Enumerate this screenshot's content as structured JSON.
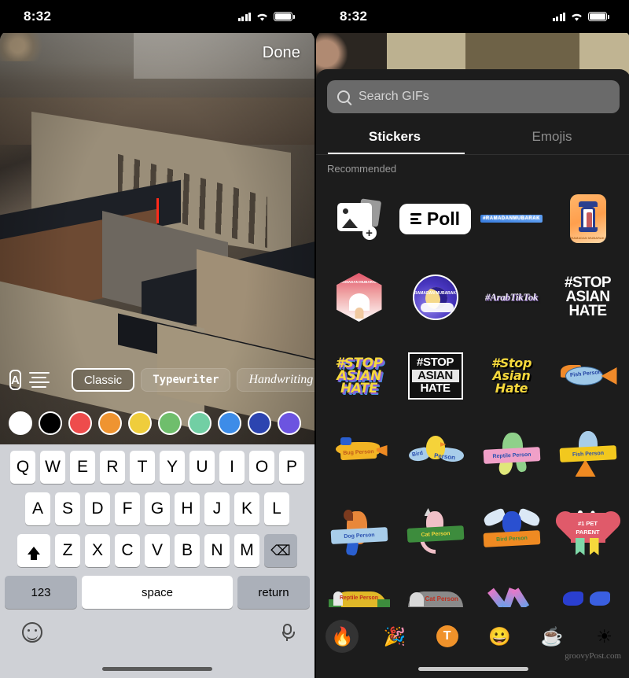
{
  "left": {
    "status": {
      "time": "8:32",
      "cellular_icon": "signal-bars-icon",
      "wifi_icon": "wifi-icon",
      "battery_icon": "battery-icon"
    },
    "done_label": "Done",
    "toolbar": {
      "text_style_icon": "letter-A-box-icon",
      "align_icon": "text-align-icon",
      "fonts": [
        {
          "label": "Classic",
          "selected": true
        },
        {
          "label": "Typewriter",
          "selected": false
        },
        {
          "label": "Handwriting",
          "selected": false
        }
      ]
    },
    "colors": [
      {
        "name": "white",
        "hex": "#FFFFFF",
        "selected": true
      },
      {
        "name": "black",
        "hex": "#000000",
        "selected": false
      },
      {
        "name": "red",
        "hex": "#EE4C4C",
        "selected": false
      },
      {
        "name": "orange",
        "hex": "#EF9431",
        "selected": false
      },
      {
        "name": "yellow",
        "hex": "#EFCD3C",
        "selected": false
      },
      {
        "name": "green",
        "hex": "#6FBE6C",
        "selected": false
      },
      {
        "name": "mint",
        "hex": "#72CFA4",
        "selected": false
      },
      {
        "name": "blue",
        "hex": "#3D8CE8",
        "selected": false
      },
      {
        "name": "navy",
        "hex": "#2C44B0",
        "selected": false
      },
      {
        "name": "purple",
        "hex": "#6C54E0",
        "selected": false
      }
    ],
    "keyboard": {
      "row1": [
        "Q",
        "W",
        "E",
        "R",
        "T",
        "Y",
        "U",
        "I",
        "O",
        "P"
      ],
      "row2": [
        "A",
        "S",
        "D",
        "F",
        "G",
        "H",
        "J",
        "K",
        "L"
      ],
      "row3": [
        "Z",
        "X",
        "C",
        "V",
        "B",
        "N",
        "M"
      ],
      "shift_icon": "shift-arrow-icon",
      "delete_icon": "backspace-icon",
      "numbers_label": "123",
      "space_label": "space",
      "return_label": "return",
      "emoji_icon": "emoji-smiley-icon",
      "dictation_icon": "microphone-icon"
    }
  },
  "right": {
    "status": {
      "time": "8:32",
      "cellular_icon": "signal-bars-icon",
      "wifi_icon": "wifi-icon",
      "battery_icon": "battery-icon"
    },
    "search": {
      "placeholder": "Search GIFs",
      "icon": "search-icon"
    },
    "tabs": [
      {
        "label": "Stickers",
        "active": true
      },
      {
        "label": "Emojis",
        "active": false
      }
    ],
    "section_title": "Recommended",
    "stickers": [
      [
        {
          "name": "add-photo-sticker",
          "label": ""
        },
        {
          "name": "poll-sticker",
          "label": "Poll"
        },
        {
          "name": "ramadan-mubarak-text-sticker",
          "label": "#RAMADANMUBARAK"
        },
        {
          "name": "ramadan-lantern-sticker",
          "label": "RAMADAN MUBARAK"
        }
      ],
      [
        {
          "name": "ramadan-mosque-hexagon-sticker",
          "label": "RAMADAN MUBARAK"
        },
        {
          "name": "ramadan-moon-circle-sticker",
          "label": "RAMADAN MUBARAK"
        },
        {
          "name": "arab-tiktok-sticker",
          "label": "#ArabTikTok"
        },
        {
          "name": "stop-asian-hate-white-sticker",
          "label": "#STOP ASIAN HATE"
        }
      ],
      [
        {
          "name": "stop-asian-hate-yellow-3d-sticker",
          "label": "#STOP ASIAN HATE"
        },
        {
          "name": "stop-asian-hate-boxed-sticker",
          "label": "#STOP ASIAN HATE"
        },
        {
          "name": "stop-asian-hate-script-sticker",
          "label": "#Stop Asian Hate"
        },
        {
          "name": "fish-person-banner-sticker",
          "label": "Fish Person"
        }
      ],
      [
        {
          "name": "bug-person-sticker",
          "label": "Bug Person"
        },
        {
          "name": "bird-person-sticker",
          "label": "Bird Person"
        },
        {
          "name": "reptile-person-sticker",
          "label": "Reptile Person"
        },
        {
          "name": "fish-person-sticker",
          "label": "Fish Person"
        }
      ],
      [
        {
          "name": "dog-person-sticker",
          "label": "Dog Person"
        },
        {
          "name": "cat-person-sticker",
          "label": "Cat Person"
        },
        {
          "name": "bird-person-orange-sticker",
          "label": "Bird Person"
        },
        {
          "name": "pet-parent-ribbon-sticker",
          "label": "#1 PET PARENT"
        }
      ],
      [
        {
          "name": "reptile-person-partial-sticker",
          "label": "Reptile Person"
        },
        {
          "name": "cat-person-partial-sticker",
          "label": "Cat Person"
        },
        {
          "name": "arrow-sticker",
          "label": ""
        },
        {
          "name": "blue-shape-sticker",
          "label": ""
        }
      ]
    ],
    "categories": [
      {
        "name": "trending-fire-category",
        "glyph": "🔥",
        "selected": true
      },
      {
        "name": "celebration-category",
        "glyph": "🎉",
        "selected": false
      },
      {
        "name": "text-category",
        "glyph": "T",
        "selected": false
      },
      {
        "name": "smileys-category",
        "glyph": "😀",
        "selected": false
      },
      {
        "name": "food-drink-category",
        "glyph": "☕",
        "selected": false
      },
      {
        "name": "weather-category",
        "glyph": "☀",
        "selected": false
      }
    ],
    "watermark": "groovyPost.com"
  }
}
